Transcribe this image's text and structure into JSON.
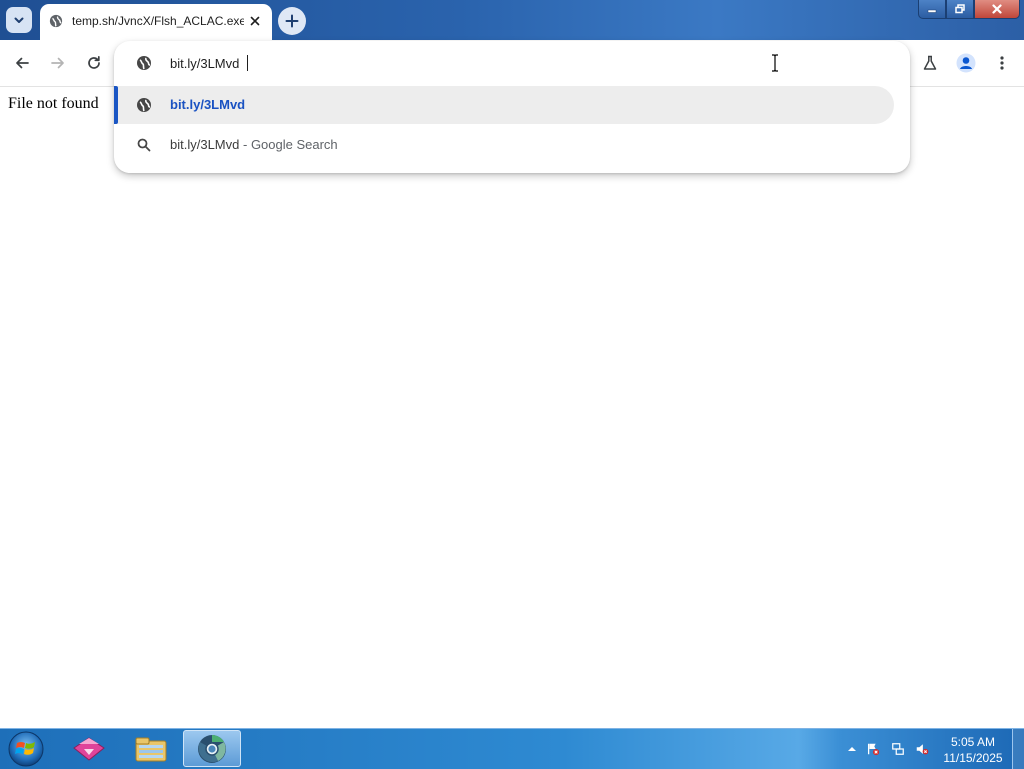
{
  "browser": {
    "tab": {
      "title": "temp.sh/JvncX/Flsh_ACLAC.exe"
    },
    "window_controls": {
      "minimize": "minimize",
      "maximize": "restore",
      "close": "close"
    }
  },
  "omnibox": {
    "input_value": "bit.ly/3LMvd",
    "suggestions": [
      {
        "icon": "globe-icon",
        "text": "bit.ly/3LMvd",
        "selected": true
      },
      {
        "icon": "search-icon",
        "query": "bit.ly/3LMvd",
        "separator": " - ",
        "engine": "Google Search",
        "selected": false
      }
    ]
  },
  "page": {
    "body_text": "File not found"
  },
  "taskbar": {
    "apps": [
      "media-player-icon",
      "file-explorer-icon",
      "browser-icon"
    ],
    "active_app": "browser-icon",
    "clock": {
      "time": "5:05 AM",
      "date": "11/15/2025"
    }
  },
  "colors": {
    "accent": "#1a56c4",
    "titlebar": "#2a63ad",
    "taskbar": "#2e8ad2"
  }
}
